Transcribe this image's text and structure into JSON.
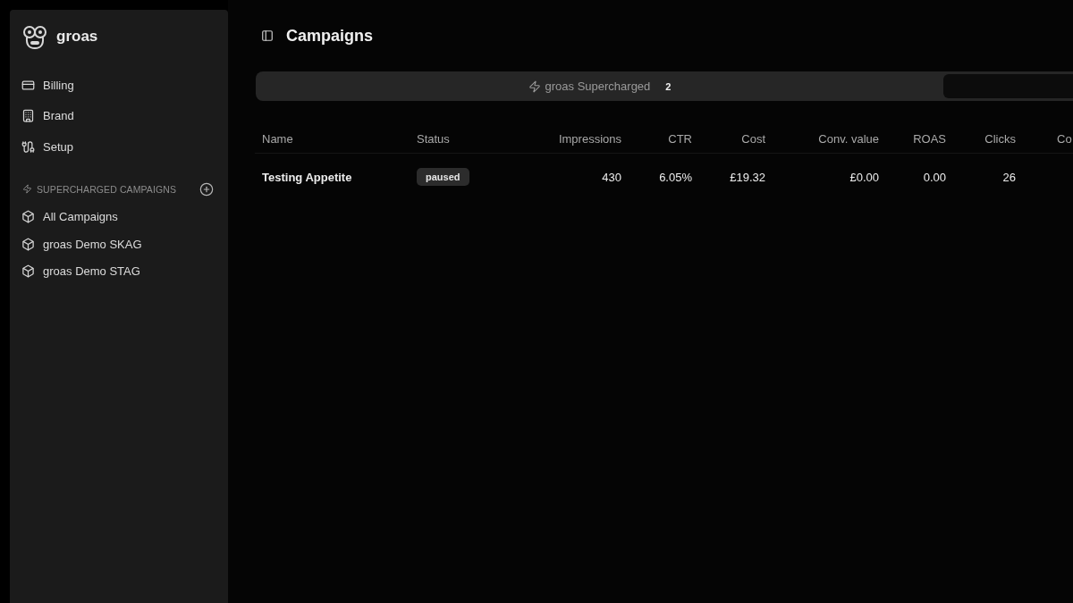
{
  "sidebar": {
    "brand": "groas",
    "nav_items": [
      {
        "label": "Billing"
      },
      {
        "label": "Brand"
      },
      {
        "label": "Setup"
      }
    ],
    "section": {
      "title": "SUPERCHARGED CAMPAIGNS",
      "items": [
        {
          "label": "All Campaigns"
        },
        {
          "label": "groas Demo SKAG"
        },
        {
          "label": "groas Demo STAG"
        }
      ]
    }
  },
  "header": {
    "title": "Campaigns"
  },
  "tabs": [
    {
      "label": "groas Supercharged",
      "count": "2",
      "selected": false
    },
    {
      "selected": true
    }
  ],
  "table": {
    "columns": [
      {
        "label": "Name",
        "kind": "text"
      },
      {
        "label": "Status",
        "kind": "status"
      },
      {
        "label": "Impressions",
        "kind": "number"
      },
      {
        "label": "CTR",
        "kind": "number"
      },
      {
        "label": "Cost",
        "kind": "number"
      },
      {
        "label": "Conv. value",
        "kind": "number"
      },
      {
        "label": "ROAS",
        "kind": "number"
      },
      {
        "label": "Clicks",
        "kind": "number"
      },
      {
        "label": "Co",
        "kind": "cut"
      }
    ],
    "rows": [
      {
        "cells": [
          "Testing Appetite",
          "paused",
          "430",
          "6.05%",
          "£19.32",
          "£0.00",
          "0.00",
          "26"
        ]
      }
    ]
  }
}
